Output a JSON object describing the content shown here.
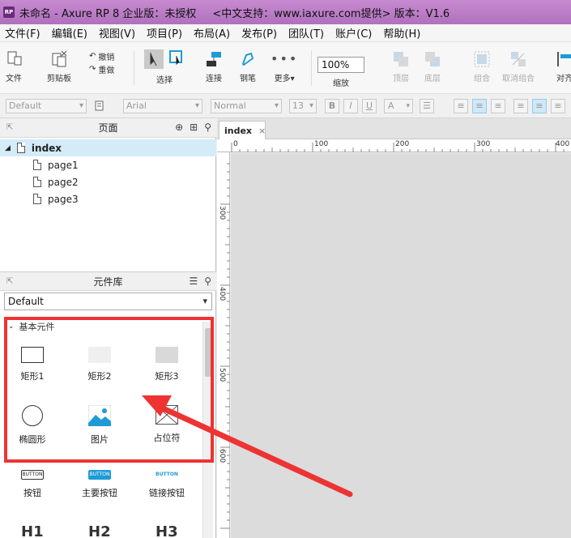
{
  "window": {
    "title": "未命名 - Axure RP 8 企业版：未授权",
    "support": "<中文支持：www.iaxure.com提供> 版本：V1.6",
    "app_icon_text": "RP"
  },
  "menu": [
    "文件(F)",
    "编辑(E)",
    "视图(V)",
    "项目(P)",
    "布局(A)",
    "发布(P)",
    "团队(T)",
    "账户(C)",
    "帮助(H)"
  ],
  "toolbar": {
    "file": "文件",
    "clipboard": "剪贴板",
    "undo": "撤销",
    "redo": "重做",
    "select": "选择",
    "connect": "连接",
    "pen": "钢笔",
    "more": "更多▾",
    "zoom_value": "100%",
    "zoom": "缩放",
    "top": "顶层",
    "bottom": "底层",
    "group": "组合",
    "ungroup": "取消组合",
    "align": "对齐"
  },
  "format": {
    "style": "Default",
    "font": "Arial",
    "weight": "Normal",
    "size": "13",
    "bold": "B",
    "italic": "I",
    "underline": "U",
    "color": "A"
  },
  "pages_panel": {
    "title": "页面",
    "pages": [
      "index",
      "page1",
      "page2",
      "page3"
    ]
  },
  "library_panel": {
    "title": "元件库",
    "selected": "Default",
    "group": "基本元件",
    "widgets": [
      "矩形1",
      "矩形2",
      "矩形3",
      "椭圆形",
      "图片",
      "占位符",
      "按钮",
      "主要按钮",
      "链接按钮"
    ],
    "button_text": "BUTTON",
    "headings": [
      "H1",
      "H2",
      "H3"
    ]
  },
  "canvas": {
    "tab": "index",
    "tab_close": "×",
    "ruler_h": [
      "0",
      "100",
      "200",
      "300",
      "400"
    ],
    "ruler_v": [
      "300",
      "400",
      "500",
      "600"
    ]
  },
  "colors": {
    "titlebar": "#b070bd",
    "selection": "#d4ebf8",
    "annotation": "#ee3333",
    "accent_blue": "#1e9bd7"
  }
}
